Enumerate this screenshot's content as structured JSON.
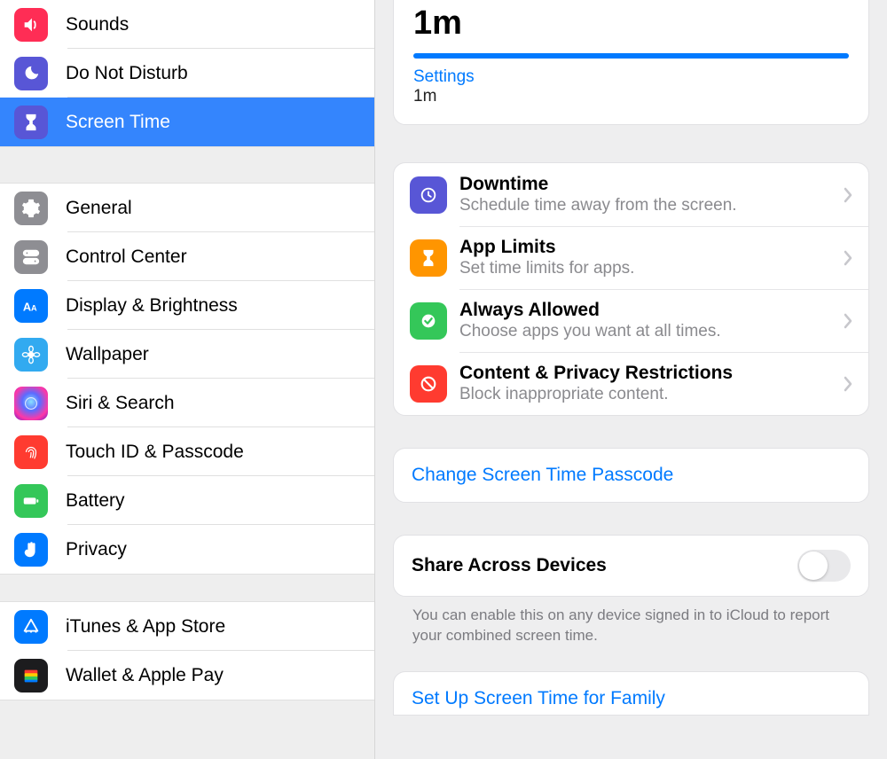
{
  "sidebar": {
    "group1": [
      {
        "key": "sounds",
        "label": "Sounds"
      },
      {
        "key": "dnd",
        "label": "Do Not Disturb"
      },
      {
        "key": "screentime",
        "label": "Screen Time"
      }
    ],
    "group2": [
      {
        "key": "general",
        "label": "General"
      },
      {
        "key": "controlcenter",
        "label": "Control Center"
      },
      {
        "key": "display",
        "label": "Display & Brightness"
      },
      {
        "key": "wallpaper",
        "label": "Wallpaper"
      },
      {
        "key": "siri",
        "label": "Siri & Search"
      },
      {
        "key": "touchid",
        "label": "Touch ID & Passcode"
      },
      {
        "key": "battery",
        "label": "Battery"
      },
      {
        "key": "privacy",
        "label": "Privacy"
      }
    ],
    "group3": [
      {
        "key": "itunes",
        "label": "iTunes & App Store"
      },
      {
        "key": "wallet",
        "label": "Wallet & Apple Pay"
      }
    ]
  },
  "detail": {
    "summary": {
      "total": "1m",
      "category_label": "Settings",
      "category_time": "1m",
      "bar_percent": 100
    },
    "options": [
      {
        "key": "downtime",
        "title": "Downtime",
        "sub": "Schedule time away from the screen."
      },
      {
        "key": "applimits",
        "title": "App Limits",
        "sub": "Set time limits for apps."
      },
      {
        "key": "alwaysallowed",
        "title": "Always Allowed",
        "sub": "Choose apps you want at all times."
      },
      {
        "key": "restrictions",
        "title": "Content & Privacy Restrictions",
        "sub": "Block inappropriate content."
      }
    ],
    "change_passcode": "Change Screen Time Passcode",
    "share_toggle": {
      "label": "Share Across Devices",
      "on": false
    },
    "share_footer": "You can enable this on any device signed in to iCloud to report your combined screen time.",
    "family_link": "Set Up Screen Time for Family"
  }
}
